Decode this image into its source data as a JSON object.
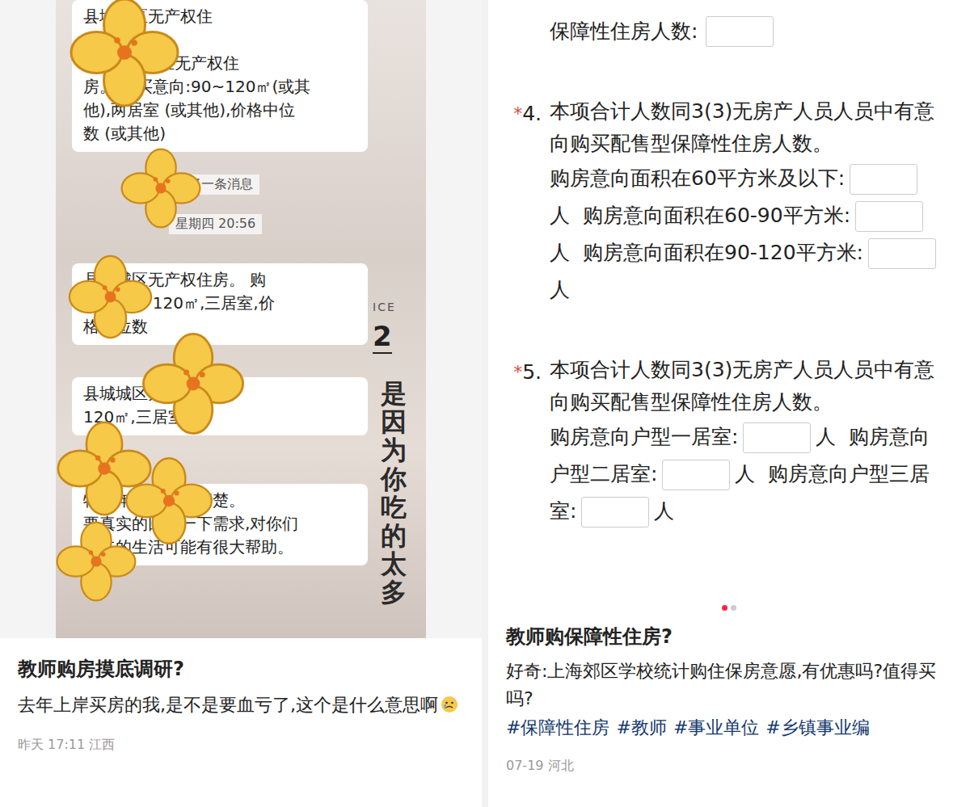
{
  "left_post": {
    "image": {
      "bubbles": [
        {
          "lines": [
            "县城城区无产权住",
            "有需 编辑:",
            "如: 县城城区无产权住",
            "房。 购买意向:90~120㎡(或其",
            "他),两居室 (或其他),价格中位",
            "数 (或其他)"
          ]
        },
        {
          "lines": [
            "县城城区无产权住房。 购",
            "买意向:9 120㎡,三居室,价",
            "格中位数"
          ]
        },
        {
          "lines": [
            "县城城区无产权住房。",
            "120㎡,三居室,"
          ]
        },
        {
          "lines": [
            "特别年轻人要看清楚。",
            "要真实的回复一下需求,对你们",
            "将来的生活可能有很大帮助。"
          ]
        }
      ],
      "notice": "回了一条消息",
      "timestamp": "星期四 20:56",
      "overlay_label": "ICE",
      "overlay_number": "2",
      "overlay_text": "是因为你吃的太多"
    },
    "title": "教师购房摸底调研?",
    "body": "去年上岸买房的我,是不是要血亏了,这个是什么意思啊",
    "footer": "昨天 17:11 江西"
  },
  "right_post": {
    "form": {
      "top_field": {
        "label": "保障性住房人数:"
      },
      "questions": [
        {
          "required": true,
          "star": "*",
          "number": "4.",
          "text": "本项合计人数同3(3)无房产人员人员中有意向购买配售型保障性住房人数。",
          "options": [
            {
              "label": "购房意向面积在60平方米及以下:",
              "unit": "人"
            },
            {
              "label": "购房意向面积在60-90平方米:",
              "unit": "人"
            },
            {
              "label": "购房意向面积在90-120平方米:",
              "unit": "人"
            }
          ]
        },
        {
          "required": true,
          "star": "*",
          "number": "5.",
          "text": "本项合计人数同3(3)无房产人员人员中有意向购买配售型保障性住房人数。",
          "options": [
            {
              "label": "购房意向户型一居室:",
              "unit": "人"
            },
            {
              "label": "购房意向户型二居室:",
              "unit": "人"
            },
            {
              "label": "购房意向户型三居室:",
              "unit": "人"
            }
          ]
        }
      ]
    },
    "dots": [
      {
        "selected": true
      },
      {
        "selected": false
      }
    ],
    "title": "教师购保障性住房?",
    "body": "好奇:上海郊区学校统计购住保房意愿,有优惠吗?值得买吗?",
    "tags": [
      "#保障性住房",
      "#教师",
      "#事业单位",
      "#乡镇事业编"
    ],
    "footer": "07-19 河北"
  }
}
